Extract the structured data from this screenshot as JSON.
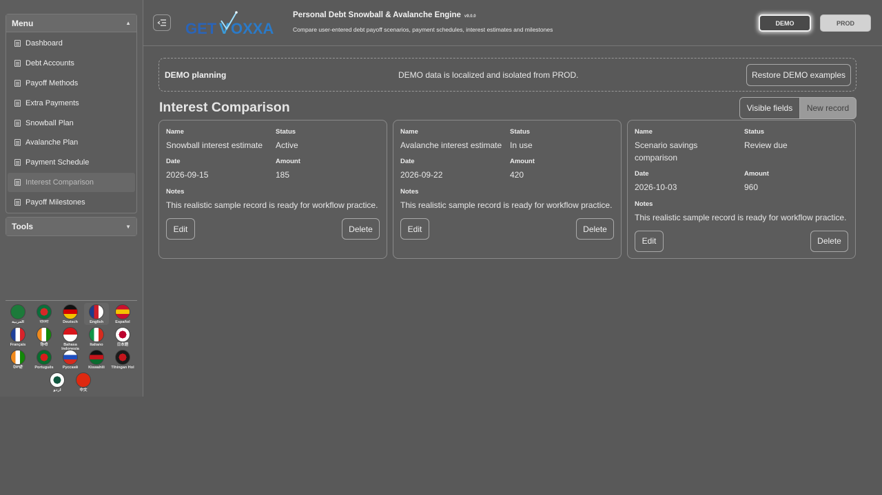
{
  "sidebar": {
    "menu_title": "Menu",
    "menu_items": [
      {
        "label": "Dashboard"
      },
      {
        "label": "Debt Accounts"
      },
      {
        "label": "Payoff Methods"
      },
      {
        "label": "Extra Payments"
      },
      {
        "label": "Snowball Plan"
      },
      {
        "label": "Avalanche Plan"
      },
      {
        "label": "Payment Schedule"
      },
      {
        "label": "Interest Comparison"
      },
      {
        "label": "Payoff Milestones"
      }
    ],
    "tools_title": "Tools",
    "languages": [
      {
        "label": "العربية",
        "colors": [
          "#1c7a3a",
          "#1c7a3a"
        ]
      },
      {
        "label": "বাংলা",
        "colors": [
          "#0b6e3a",
          "#d62828"
        ]
      },
      {
        "label": "Deutsch",
        "colors": [
          "#111111",
          "#d40000",
          "#f2c200"
        ]
      },
      {
        "label": "English",
        "colors": [
          "#1d3b8a",
          "#cc1e2b",
          "#ffffff"
        ]
      },
      {
        "label": "Español",
        "colors": [
          "#c8102e",
          "#f4c300",
          "#c8102e"
        ]
      },
      {
        "label": "Français",
        "colors": [
          "#1f3f99",
          "#ffffff",
          "#d8232a"
        ]
      },
      {
        "label": "हिन्दी",
        "colors": [
          "#f08a1c",
          "#ffffff",
          "#138808"
        ]
      },
      {
        "label": "Bahasa Indonesia",
        "colors": [
          "#d9151b",
          "#ffffff"
        ]
      },
      {
        "label": "Italiano",
        "colors": [
          "#129447",
          "#ffffff",
          "#d52b1e"
        ]
      },
      {
        "label": "日本語",
        "colors": [
          "#ffffff",
          "#bc002d"
        ]
      },
      {
        "label": "ਪੰਜਾਬੀ",
        "colors": [
          "#f08a1c",
          "#ffffff",
          "#138808"
        ]
      },
      {
        "label": "Português",
        "colors": [
          "#0a6b2e",
          "#d91b1b"
        ]
      },
      {
        "label": "Русский",
        "colors": [
          "#ffffff",
          "#1f4fbf",
          "#d52b1e"
        ]
      },
      {
        "label": "Kiswahili",
        "colors": [
          "#111111",
          "#c4151c",
          "#0a6b2e"
        ]
      },
      {
        "label": "Tlhingan Hol",
        "colors": [
          "#1a1a1a",
          "#c4151c"
        ]
      },
      {
        "label": "اردو",
        "colors": [
          "#ffffff",
          "#115740"
        ]
      },
      {
        "label": "中文",
        "colors": [
          "#de2910",
          "#de2910"
        ]
      }
    ]
  },
  "header": {
    "logo_text": "GETVOXXA",
    "title": "Personal Debt Snowball & Avalanche Engine",
    "version": "v9.0.0",
    "subtitle": "Compare user-entered debt payoff scenarios, payment schedules, interest estimates and milestones",
    "demo_label": "DEMO",
    "prod_label": "PROD"
  },
  "banner": {
    "title": "DEMO planning",
    "text": "DEMO data is localized and isolated from PROD.",
    "restore_label": "Restore DEMO examples"
  },
  "section": {
    "title": "Interest Comparison",
    "visible_fields_label": "Visible fields",
    "new_record_label": "New record"
  },
  "labels": {
    "name": "Name",
    "status": "Status",
    "date": "Date",
    "amount": "Amount",
    "notes": "Notes",
    "edit": "Edit",
    "delete": "Delete"
  },
  "records": [
    {
      "name": "Snowball interest estimate",
      "status": "Active",
      "date": "2026-09-15",
      "amount": "185",
      "notes": "This realistic sample record is ready for workflow practice."
    },
    {
      "name": "Avalanche interest estimate",
      "status": "In use",
      "date": "2026-09-22",
      "amount": "420",
      "notes": "This realistic sample record is ready for workflow practice."
    },
    {
      "name": "Scenario savings comparison",
      "status": "Review due",
      "date": "2026-10-03",
      "amount": "960",
      "notes": "This realistic sample record is ready for workflow practice."
    }
  ]
}
